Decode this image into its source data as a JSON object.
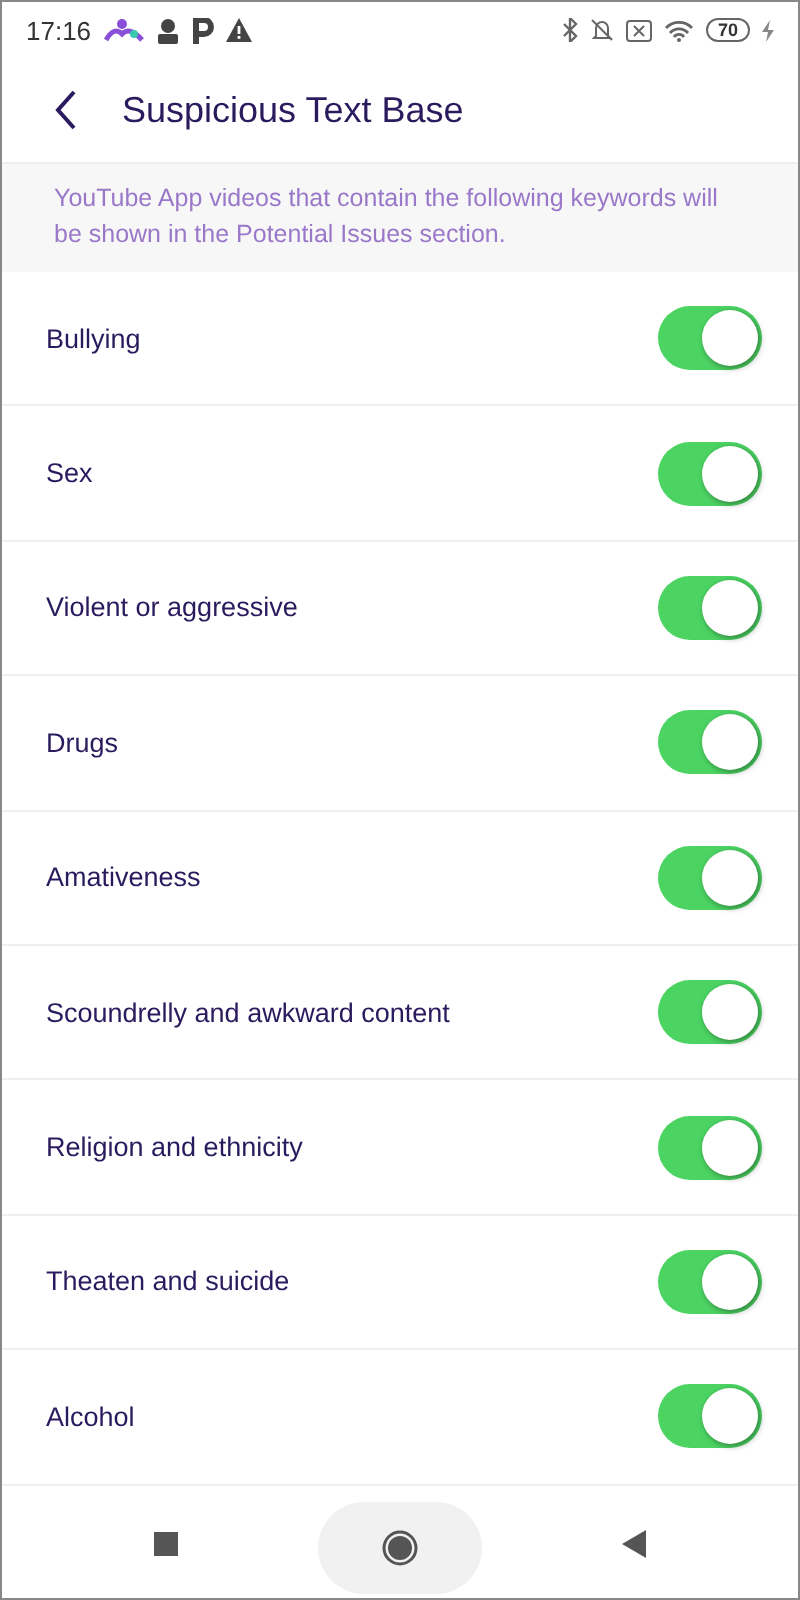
{
  "status_bar": {
    "time": "17:16",
    "battery": "70"
  },
  "header": {
    "title": "Suspicious Text Base"
  },
  "notice": "YouTube App videos that contain the following keywords will be shown in the Potential Issues section.",
  "items": [
    {
      "label": "Bullying",
      "on": true
    },
    {
      "label": "Sex",
      "on": true
    },
    {
      "label": "Violent or aggressive",
      "on": true
    },
    {
      "label": "Drugs",
      "on": true
    },
    {
      "label": "Amativeness",
      "on": true
    },
    {
      "label": "Scoundrelly and awkward content",
      "on": true
    },
    {
      "label": "Religion and ethnicity",
      "on": true
    },
    {
      "label": "Theaten and suicide",
      "on": true
    },
    {
      "label": "Alcohol",
      "on": true
    }
  ]
}
